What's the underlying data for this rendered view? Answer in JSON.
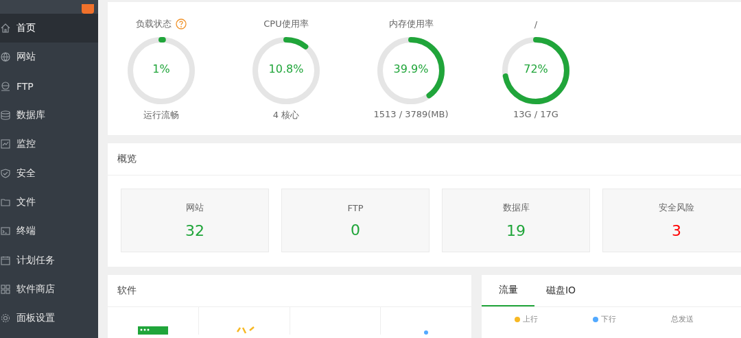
{
  "sidebar": {
    "items": [
      {
        "label": "首页",
        "selected": true
      },
      {
        "label": "网站",
        "selected": false
      },
      {
        "label": "FTP",
        "selected": false
      },
      {
        "label": "数据库",
        "selected": false
      },
      {
        "label": "监控",
        "selected": false
      },
      {
        "label": "安全",
        "selected": false
      },
      {
        "label": "文件",
        "selected": false
      },
      {
        "label": "终端",
        "selected": false
      },
      {
        "label": "计划任务",
        "selected": false
      },
      {
        "label": "软件商店",
        "selected": false
      },
      {
        "label": "面板设置",
        "selected": false
      }
    ]
  },
  "status": {
    "gauges": [
      {
        "title": "负载状态",
        "help": true,
        "value": "1%",
        "level": 0.01,
        "caption": "运行流畅"
      },
      {
        "title": "CPU使用率",
        "help": false,
        "value": "10.8%",
        "level": 0.108,
        "caption": "4 核心"
      },
      {
        "title": "内存使用率",
        "help": false,
        "value": "39.9%",
        "level": 0.399,
        "caption": "1513 / 3789(MB)"
      },
      {
        "title": "/",
        "help": false,
        "value": "72%",
        "level": 0.72,
        "caption": "13G / 17G"
      }
    ]
  },
  "overview": {
    "title": "概览",
    "stats": [
      {
        "label": "网站",
        "value": "32",
        "alert": false
      },
      {
        "label": "FTP",
        "value": "0",
        "alert": false
      },
      {
        "label": "数据库",
        "value": "19",
        "alert": false
      },
      {
        "label": "安全风险",
        "value": "3",
        "alert": true
      }
    ]
  },
  "software": {
    "title": "软件"
  },
  "traffic": {
    "tabs": [
      {
        "label": "流量",
        "selected": true
      },
      {
        "label": "磁盘IO",
        "selected": false
      }
    ],
    "legend": [
      {
        "label": "上行",
        "color": "#f7b824"
      },
      {
        "label": "下行",
        "color": "#52a9ff"
      },
      {
        "label": "总发送"
      }
    ]
  }
}
